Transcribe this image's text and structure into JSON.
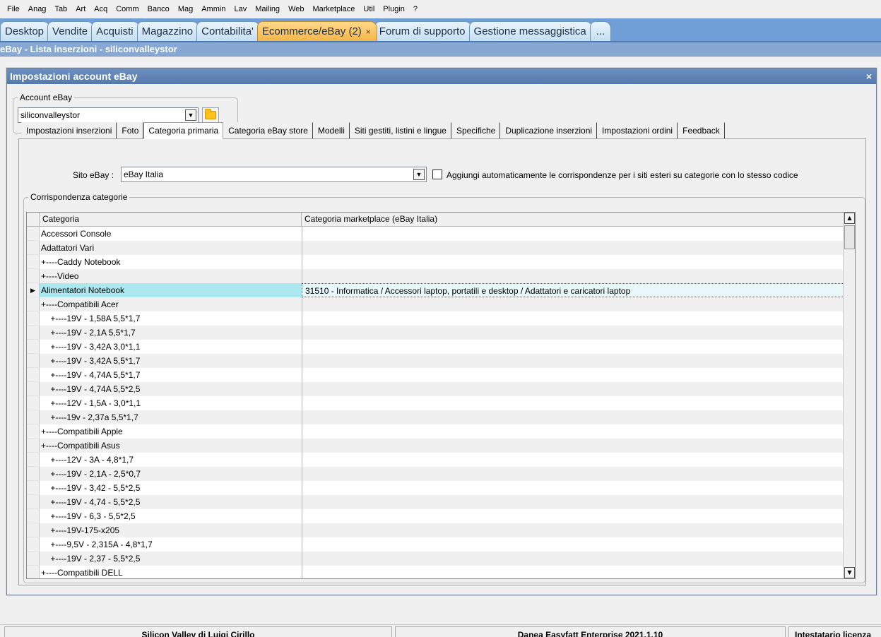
{
  "menu": [
    "File",
    "Anag",
    "Tab",
    "Art",
    "Acq",
    "Comm",
    "Banco",
    "Mag",
    "Ammin",
    "Lav",
    "Mailing",
    "Web",
    "Marketplace",
    "Util",
    "Plugin",
    "?"
  ],
  "tabs": [
    {
      "label": "Desktop"
    },
    {
      "label": "Vendite"
    },
    {
      "label": "Acquisti"
    },
    {
      "label": "Magazzino"
    },
    {
      "label": "Contabilita'"
    },
    {
      "label": "Ecommerce/eBay (2)",
      "active": true,
      "close": "×"
    },
    {
      "label": "Forum di supporto"
    },
    {
      "label": "Gestione messaggistica"
    },
    {
      "label": "..."
    }
  ],
  "page_title": "eBay - Lista inserzioni - siliconvalleystor",
  "dialog": {
    "title": "Impostazioni account eBay",
    "close": "×",
    "account_group_label": "Account eBay",
    "account_value": "siliconvalleystor",
    "inner_tabs": [
      "Impostazioni inserzioni",
      "Foto",
      "Categoria primaria",
      "Categoria eBay store",
      "Modelli",
      "Siti gestiti, listini e lingue",
      "Specifiche",
      "Duplicazione inserzioni",
      "Impostazioni ordini",
      "Feedback"
    ],
    "active_inner_tab": "Categoria primaria",
    "site_label": "Sito eBay :",
    "site_value": "eBay Italia",
    "auto_checkbox_label": "Aggiungi automaticamente le corrispondenze per i siti esteri su categorie con lo stesso codice",
    "auto_checked": false,
    "mapping_group_label": "Corrispondenza categorie",
    "grid": {
      "columns": [
        "Categoria",
        "Categoria marketplace (eBay Italia)"
      ],
      "rows": [
        {
          "category": "Accessori Console",
          "marketplace": ""
        },
        {
          "category": "Adattatori Vari",
          "marketplace": ""
        },
        {
          "category": "+----Caddy Notebook",
          "marketplace": ""
        },
        {
          "category": "+----Video",
          "marketplace": ""
        },
        {
          "category": "Alimentatori Notebook",
          "marketplace": "31510 - Informatica / Accessori laptop, portatili e desktop / Adattatori e caricatori laptop",
          "selected": true,
          "indicator": "▶"
        },
        {
          "category": "+----Compatibili Acer",
          "marketplace": ""
        },
        {
          "category": "    +----19V - 1,58A 5,5*1,7",
          "marketplace": ""
        },
        {
          "category": "    +----19V - 2,1A 5,5*1,7",
          "marketplace": ""
        },
        {
          "category": "    +----19V - 3,42A 3,0*1,1",
          "marketplace": ""
        },
        {
          "category": "    +----19V - 3,42A 5,5*1,7",
          "marketplace": ""
        },
        {
          "category": "    +----19V - 4,74A 5,5*1,7",
          "marketplace": ""
        },
        {
          "category": "    +----19V - 4,74A 5,5*2,5",
          "marketplace": ""
        },
        {
          "category": "    +----12V - 1,5A - 3,0*1,1",
          "marketplace": ""
        },
        {
          "category": "    +----19v - 2,37a 5,5*1,7",
          "marketplace": ""
        },
        {
          "category": "+----Compatibili Apple",
          "marketplace": ""
        },
        {
          "category": "+----Compatibili Asus",
          "marketplace": ""
        },
        {
          "category": "    +----12V - 3A - 4,8*1,7",
          "marketplace": ""
        },
        {
          "category": "    +----19V - 2,1A - 2,5*0,7",
          "marketplace": ""
        },
        {
          "category": "    +----19V - 3,42 - 5,5*2,5",
          "marketplace": ""
        },
        {
          "category": "    +----19V - 4,74 - 5,5*2,5",
          "marketplace": ""
        },
        {
          "category": "    +----19V - 6,3 - 5,5*2,5",
          "marketplace": ""
        },
        {
          "category": "    +----19V-175-x205",
          "marketplace": ""
        },
        {
          "category": "    +----9,5V - 2,315A - 4,8*1,7",
          "marketplace": ""
        },
        {
          "category": "    +----19V - 2,37 - 5,5*2,5",
          "marketplace": ""
        },
        {
          "category": "+----Compatibili DELL",
          "marketplace": ""
        }
      ]
    }
  },
  "statusbar": {
    "left": "Silicon Valley di Luigi Cirillo",
    "center": "Danea Easyfatt Enterprise 2021.1.10",
    "right": "Intestatario licenza"
  },
  "colors": {
    "tabstrip": "#6f9fd6",
    "active_tab": "#f4b548",
    "selected_row": "#ace8ef",
    "dialog_title": "#5679ad"
  }
}
